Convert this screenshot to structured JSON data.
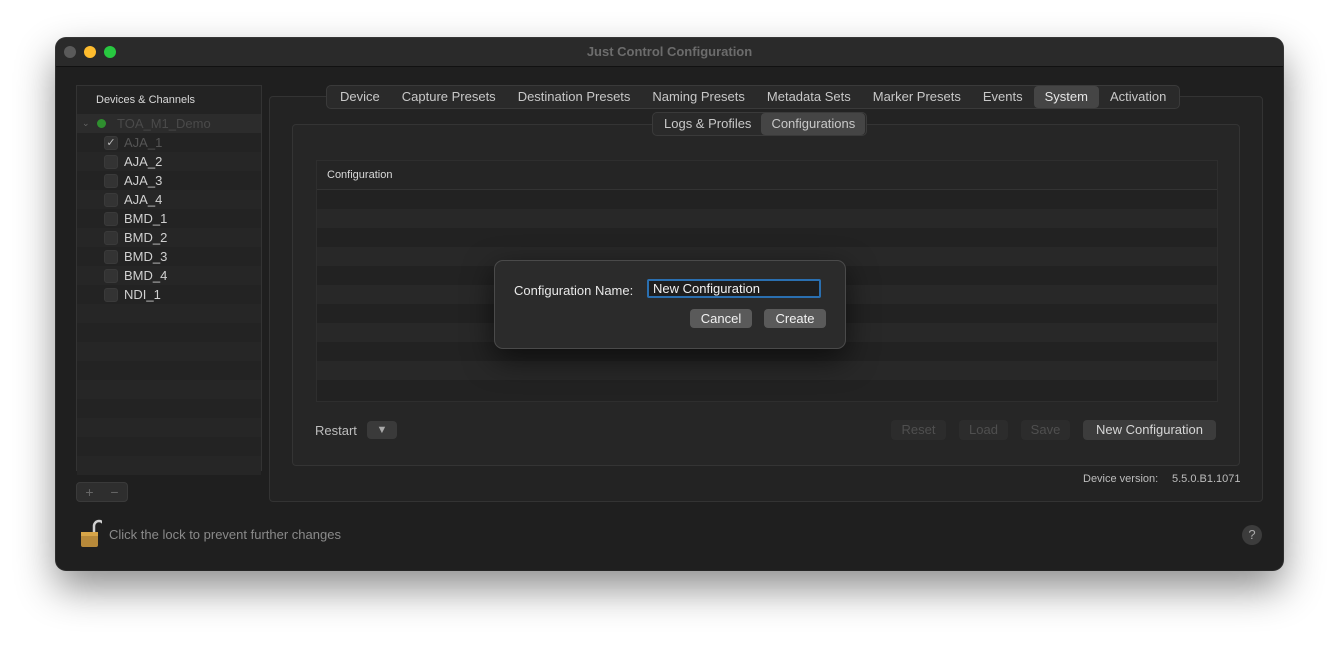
{
  "window": {
    "title": "Just Control Configuration"
  },
  "sidebar": {
    "header": "Devices & Channels",
    "group": "TOA_M1_Demo",
    "channels": [
      {
        "label": "AJA_1",
        "checked": true
      },
      {
        "label": "AJA_2",
        "checked": false
      },
      {
        "label": "AJA_3",
        "checked": false
      },
      {
        "label": "AJA_4",
        "checked": false
      },
      {
        "label": "BMD_1",
        "checked": false
      },
      {
        "label": "BMD_2",
        "checked": false
      },
      {
        "label": "BMD_3",
        "checked": false
      },
      {
        "label": "BMD_4",
        "checked": false
      },
      {
        "label": "NDI_1",
        "checked": false
      }
    ],
    "add_label": "+",
    "remove_label": "−"
  },
  "tabs": [
    "Device",
    "Capture Presets",
    "Destination Presets",
    "Naming Presets",
    "Metadata Sets",
    "Marker Presets",
    "Events",
    "System",
    "Activation"
  ],
  "active_tab": "System",
  "subtabs": [
    "Logs & Profiles",
    "Configurations"
  ],
  "active_subtab": "Configurations",
  "table": {
    "header": "Configuration"
  },
  "footer": {
    "restart_label": "Restart",
    "restart_arrow": "▼",
    "reset": "Reset",
    "load": "Load",
    "save": "Save",
    "new_configuration": "New Configuration"
  },
  "device_version": {
    "label": "Device version:",
    "value": "5.5.0.B1.1071"
  },
  "lock_text": "Click the lock to prevent further changes",
  "help_label": "?",
  "dialog": {
    "label": "Configuration Name:",
    "input_value": "New Configuration",
    "cancel": "Cancel",
    "create": "Create"
  }
}
